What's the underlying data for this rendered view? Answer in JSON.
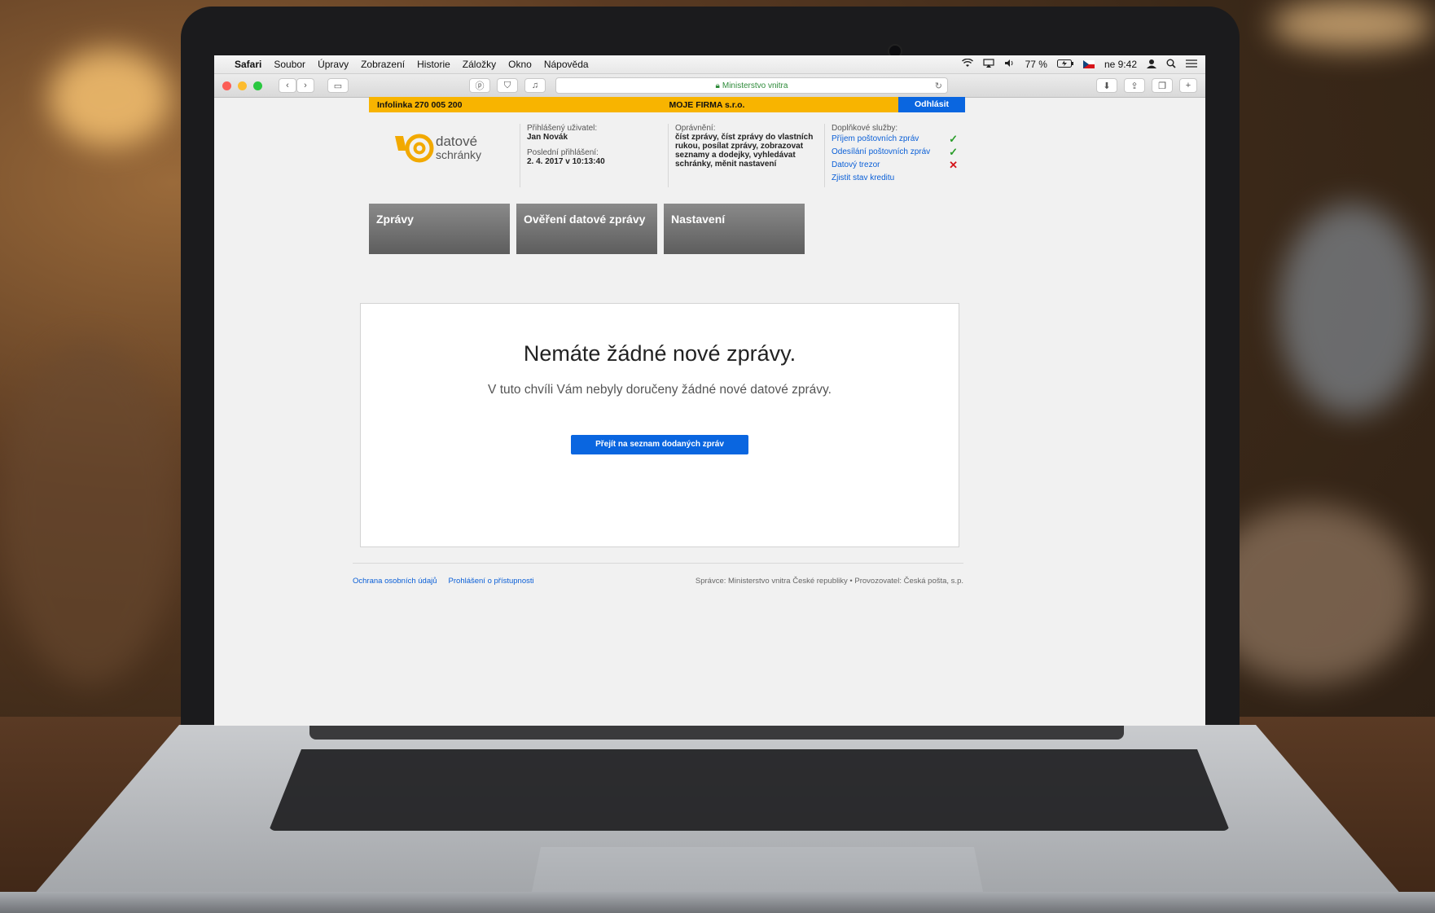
{
  "menubar": {
    "app": "Safari",
    "items": [
      "Soubor",
      "Úpravy",
      "Zobrazení",
      "Historie",
      "Záložky",
      "Okno",
      "Nápověda"
    ],
    "battery": "77 %",
    "clock": "ne 9:42"
  },
  "toolbar": {
    "url_text": "Ministerstvo vnitra"
  },
  "infobar": {
    "phone": "Infolinka 270 005 200",
    "firm": "MOJE FIRMA s.r.o.",
    "logout": "Odhlásit"
  },
  "logo": {
    "line1": "datové",
    "line2": "schránky"
  },
  "user": {
    "logged_label": "Přihlášený uživatel:",
    "name": "Jan Novák",
    "last_login_label": "Poslední přihlášení:",
    "last_login": "2. 4. 2017 v 10:13:40"
  },
  "permissions": {
    "label": "Oprávnění:",
    "text": "číst zprávy, číst zprávy do vlastních rukou, posílat zprávy, zobrazovat seznamy a dodejky, vyhledávat schránky, měnit nastavení"
  },
  "services": {
    "label": "Doplňkové služby:",
    "items": [
      {
        "label": "Příjem poštovních zpráv",
        "status": "✓"
      },
      {
        "label": "Odesílání poštovních zpráv",
        "status": "✓"
      },
      {
        "label": "Datový trezor",
        "status": "✕"
      },
      {
        "label": "Zjistit stav kreditu",
        "status": ""
      }
    ]
  },
  "tabs": [
    "Zprávy",
    "Ověření datové zprávy",
    "Nastavení"
  ],
  "main": {
    "heading": "Nemáte žádné nové zprávy.",
    "subtext": "V tuto chvíli Vám nebyly doručeny žádné nové datové zprávy.",
    "button": "Přejít na seznam dodaných zpráv"
  },
  "footer": {
    "links": [
      "Ochrana osobních údajů",
      "Prohlášení o přístupnosti"
    ],
    "right": "Správce: Ministerstvo vnitra České republiky • Provozovatel: Česká pošta, s.p."
  },
  "colors": {
    "accent": "#0a66e0",
    "infobar": "#f8b400",
    "logo": "#f2a900"
  },
  "icons": [
    "apple-icon",
    "wifi-icon",
    "airplay-icon",
    "volume-icon",
    "battery-icon",
    "flag-cz-icon",
    "user-icon",
    "search-icon",
    "list-icon",
    "back-icon",
    "forward-icon",
    "sidebar-icon",
    "pinterest-icon",
    "shield-icon",
    "extension-icon",
    "lock-icon",
    "reload-icon",
    "download-icon",
    "share-icon",
    "tabs-icon",
    "new-tab-icon"
  ]
}
